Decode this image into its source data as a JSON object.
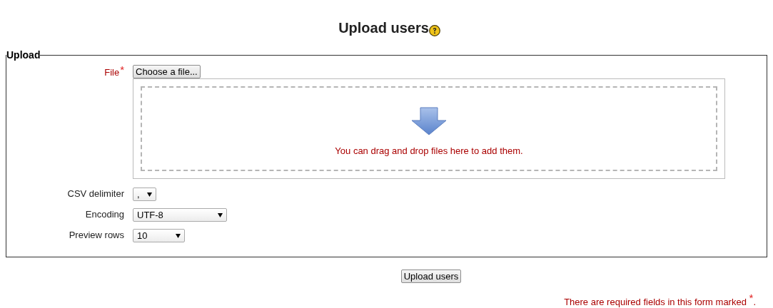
{
  "heading": {
    "title": "Upload users"
  },
  "fieldset": {
    "legend": "Upload"
  },
  "file_field": {
    "label": "File",
    "required": true,
    "required_mark": "*",
    "button": "Choose a file...",
    "dropzone_text": "You can drag and drop files here to add them."
  },
  "selects": [
    {
      "label": "CSV delimiter",
      "value": ","
    },
    {
      "label": "Encoding",
      "value": "UTF-8"
    },
    {
      "label": "Preview rows",
      "value": "10"
    }
  ],
  "submit": "Upload users",
  "required_note": "There are required fields in this form marked $^{*}$."
}
